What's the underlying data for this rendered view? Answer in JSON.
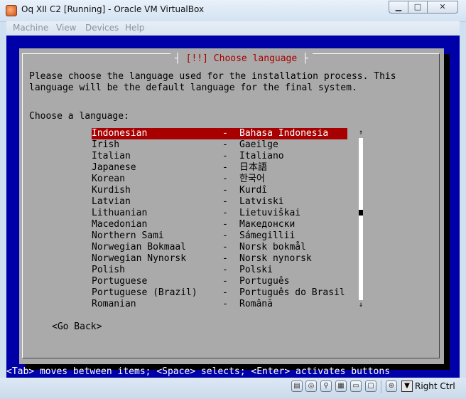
{
  "window": {
    "title": "Oq XII C2 [Running] - Oracle VM VirtualBox",
    "min_glyph": "▁",
    "max_glyph": "□",
    "close_glyph": "✕"
  },
  "menubar": {
    "items": [
      "Machine",
      "View",
      "Devices",
      "Help"
    ]
  },
  "dialog": {
    "title_open": "[!!]",
    "title": "Choose language",
    "intro_line1": "Please choose the language used for the installation process. This",
    "intro_line2": "language will be the default language for the final system.",
    "prompt": "Choose a language:",
    "separator": "-",
    "languages": [
      {
        "name": "Indonesian",
        "native": "Bahasa Indonesia",
        "selected": true
      },
      {
        "name": "Irish",
        "native": "Gaeilge"
      },
      {
        "name": "Italian",
        "native": "Italiano"
      },
      {
        "name": "Japanese",
        "native": "日本語"
      },
      {
        "name": "Korean",
        "native": "한국어"
      },
      {
        "name": "Kurdish",
        "native": "Kurdî"
      },
      {
        "name": "Latvian",
        "native": "Latviski"
      },
      {
        "name": "Lithuanian",
        "native": "Lietuviškai"
      },
      {
        "name": "Macedonian",
        "native": "Македонски"
      },
      {
        "name": "Northern Sami",
        "native": "Sámegillii"
      },
      {
        "name": "Norwegian Bokmaal",
        "native": "Norsk bokmål"
      },
      {
        "name": "Norwegian Nynorsk",
        "native": "Norsk nynorsk"
      },
      {
        "name": "Polish",
        "native": "Polski"
      },
      {
        "name": "Portuguese",
        "native": "Português"
      },
      {
        "name": "Portuguese (Brazil)",
        "native": "Português do Brasil"
      },
      {
        "name": "Romanian",
        "native": "Română"
      }
    ],
    "scroll_up_glyph": "↑",
    "scroll_down_glyph": "↓",
    "scroll_position": 0.46,
    "go_back": "<Go Back>"
  },
  "help_line": "<Tab> moves between items; <Space> selects; <Enter> activates buttons",
  "statusbar": {
    "icons": [
      "hard-disk-icon",
      "optical-disk-icon",
      "usb-icon",
      "network-icon",
      "shared-folder-icon",
      "display-icon",
      "capture-icon",
      "mouse-integration-icon"
    ],
    "host_key": "Right Ctrl"
  },
  "colors": {
    "screen_bg": "#0000a8",
    "dialog_bg": "#aaaaaa",
    "selection": "#a80000",
    "title_text": "#a80000"
  }
}
